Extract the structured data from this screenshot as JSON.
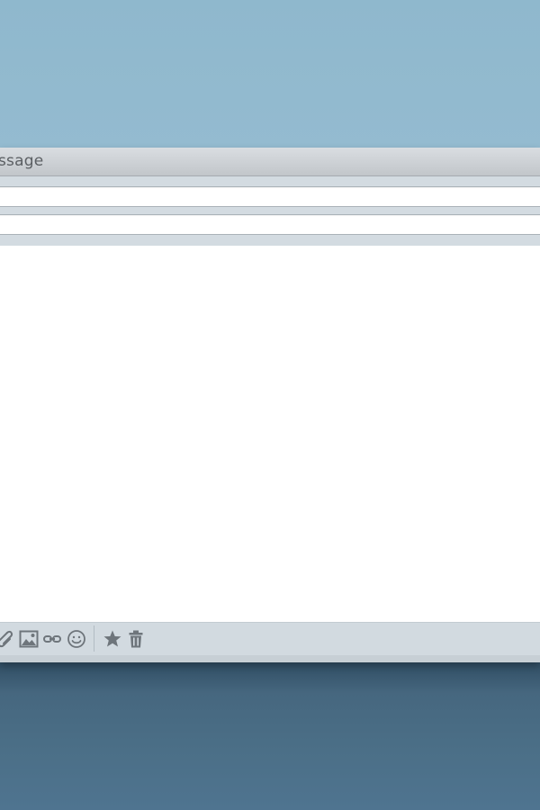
{
  "window": {
    "title": "ssage"
  },
  "toolbar": {
    "icons": [
      "paperclip-icon",
      "image-icon",
      "link-icon",
      "emoji-icon",
      "star-icon",
      "trash-icon"
    ]
  },
  "colors": {
    "sky": "#8fb8cd",
    "ground": "#4b6f87",
    "titlebar": "#c7cbcf",
    "panel": "#d3dbe1",
    "icon": "#6e757b"
  }
}
